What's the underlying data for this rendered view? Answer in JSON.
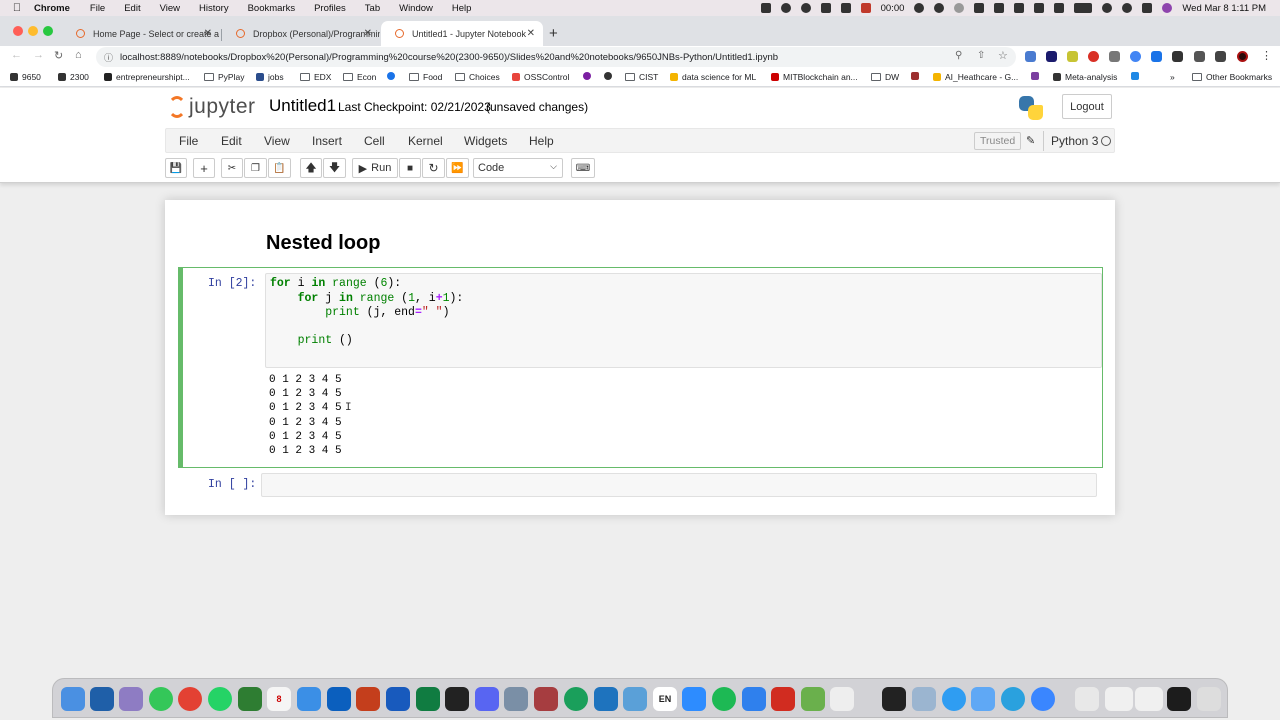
{
  "menubar": {
    "app_name": "Chrome",
    "items": [
      "File",
      "Edit",
      "View",
      "History",
      "Bookmarks",
      "Profiles",
      "Tab",
      "Window",
      "Help"
    ],
    "timer": "00:00",
    "clock": "Wed Mar 8  1:11 PM"
  },
  "tabs": [
    {
      "title": "Home Page - Select or create a"
    },
    {
      "title": "Dropbox (Personal)/Programmin"
    },
    {
      "title": "Untitled1 - Jupyter Notebook"
    }
  ],
  "address": {
    "url": "localhost:8889/notebooks/Dropbox%20(Personal)/Programming%20course%20(2300-9650)/Slides%20and%20notebooks/9650JNBs-Python/Untitled1.ipynb"
  },
  "bookmarks": [
    "9650",
    "2300",
    "entrepreneurshipt...",
    "PyPlay",
    "jobs",
    "EDX",
    "Econ",
    "Food",
    "Choices",
    "OSSControl",
    "CIST",
    "data science for ML",
    "MITBlockchain an...",
    "DW",
    "AI_Heathcare - G...",
    "Meta-analysis",
    "Other Bookmarks"
  ],
  "jupyter": {
    "logo_text": "jupyter",
    "notebook_name": "Untitled1",
    "checkpoint": "Last Checkpoint: 02/21/2023",
    "unsaved": "(unsaved changes)",
    "logout": "Logout",
    "menu": [
      "File",
      "Edit",
      "View",
      "Insert",
      "Cell",
      "Kernel",
      "Widgets",
      "Help"
    ],
    "trusted": "Trusted",
    "kernel": "Python 3",
    "run_label": "Run",
    "cell_type": "Code"
  },
  "notebook": {
    "markdown_heading": "Nested loop",
    "code_prompt": "In [2]:",
    "code_lines": {
      "l1_kw": "for",
      "l1_a": " i ",
      "l1_in": "in",
      "l1_b": " ",
      "l1_range": "range",
      "l1_c": " (",
      "l1_n": "6",
      "l1_d": "):",
      "l2_ind": "    ",
      "l2_kw": "for",
      "l2_a": " j ",
      "l2_in": "in",
      "l2_b": " ",
      "l2_range": "range",
      "l2_c": " (",
      "l2_n1": "1",
      "l2_d": ", i",
      "l2_op": "+",
      "l2_n2": "1",
      "l2_e": "):",
      "l3_ind": "        ",
      "l3_print": "print",
      "l3_a": " (j, end",
      "l3_op": "=",
      "l3_str": "\" \"",
      "l3_b": ")",
      "l5_ind": "    ",
      "l5_print": "print",
      "l5_a": " ()"
    },
    "output_lines": [
      "0 1 2 3 4 5",
      "0 1 2 3 4 5",
      "0 1 2 3 4 5",
      "0 1 2 3 4 5",
      "0 1 2 3 4 5",
      "0 1 2 3 4 5"
    ],
    "empty_prompt": "In [ ]:"
  },
  "colors": {
    "jupyter_orange": "#f37726",
    "cell_selected_border": "#66bb6a",
    "prompt_blue": "#303f9f"
  }
}
